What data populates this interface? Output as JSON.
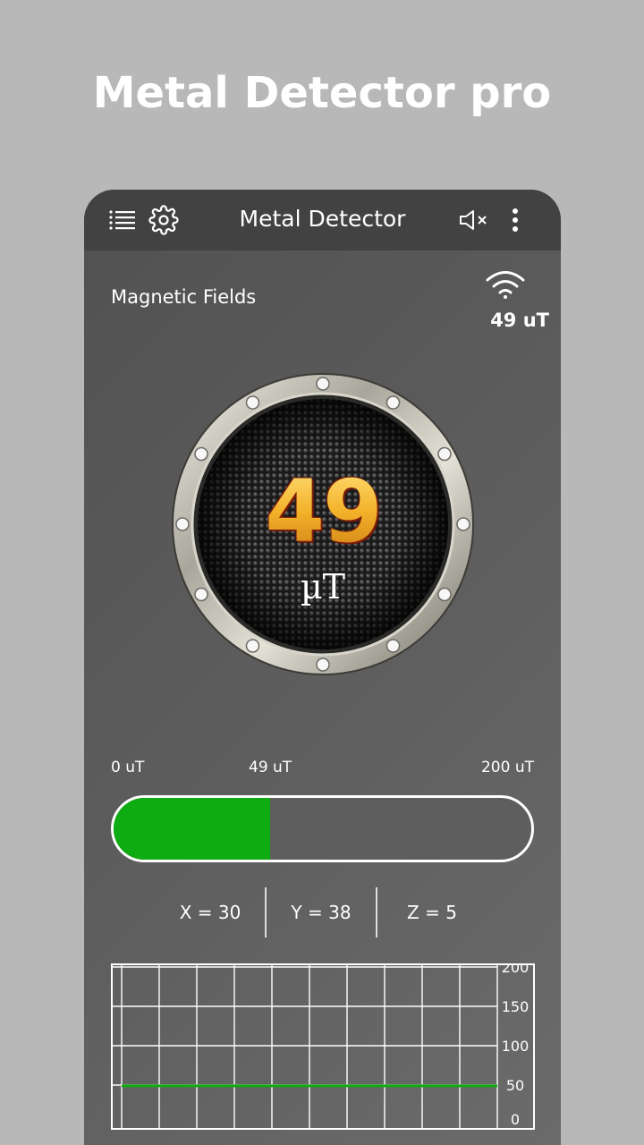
{
  "promo": {
    "title": "Metal Detector pro"
  },
  "appbar": {
    "title": "Metal Detector",
    "icons": [
      "menu-icon",
      "gear-icon",
      "volume-mute-icon",
      "more-vert-icon"
    ]
  },
  "fields": {
    "label": "Magnetic Fields",
    "signal_icon": "wifi-icon",
    "value": "49 uT"
  },
  "gauge": {
    "value": "49",
    "unit": "µT"
  },
  "scale": {
    "min_label": "0 uT",
    "current_label": "49 uT",
    "max_label": "200 uT",
    "fraction": 0.375
  },
  "axes": {
    "x": "X = 30",
    "y": "Y = 38",
    "z": "Z = 5"
  },
  "chart_data": {
    "type": "line",
    "y_ticks": [
      "200",
      "150",
      "100",
      "50",
      "0"
    ],
    "ylim": [
      0,
      200
    ],
    "series": [
      {
        "values": [
          49,
          49,
          49,
          49,
          49,
          49,
          49,
          49,
          49,
          49,
          49
        ]
      }
    ],
    "grid": true
  },
  "colors": {
    "accent": "#0fab12",
    "appbar": "#424242",
    "background": "#b8b8b8"
  }
}
